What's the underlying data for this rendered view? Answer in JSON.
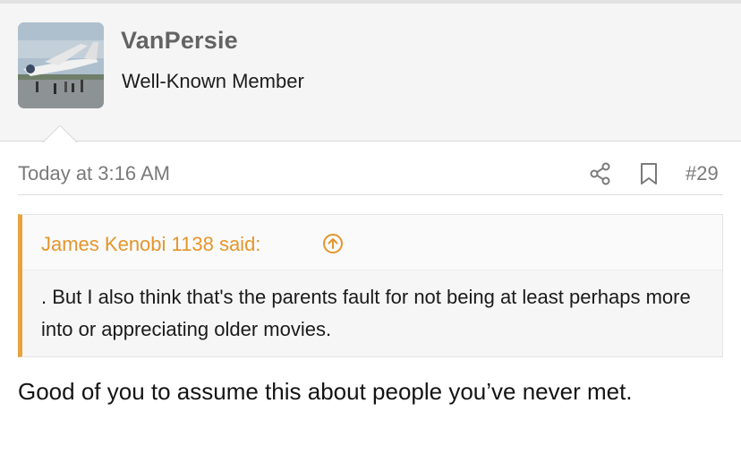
{
  "user": {
    "name": "VanPersie",
    "title": "Well-Known Member",
    "avatar_icon": "airplane-photo"
  },
  "post": {
    "timestamp": "Today at 3:16 AM",
    "number": "#29",
    "share_icon": "share-icon",
    "bookmark_icon": "bookmark-icon",
    "quote": {
      "author_line": "James Kenobi 1138 said:",
      "text": ". But I also think that's the parents fault for not being at least perhaps more into or appreciating older movies."
    },
    "body": "Good of you to assume this about people you’ve never met."
  },
  "colors": {
    "quote_accent": "#e8a33a",
    "quote_author": "#e3962c",
    "muted_text": "#7a7a7a"
  }
}
